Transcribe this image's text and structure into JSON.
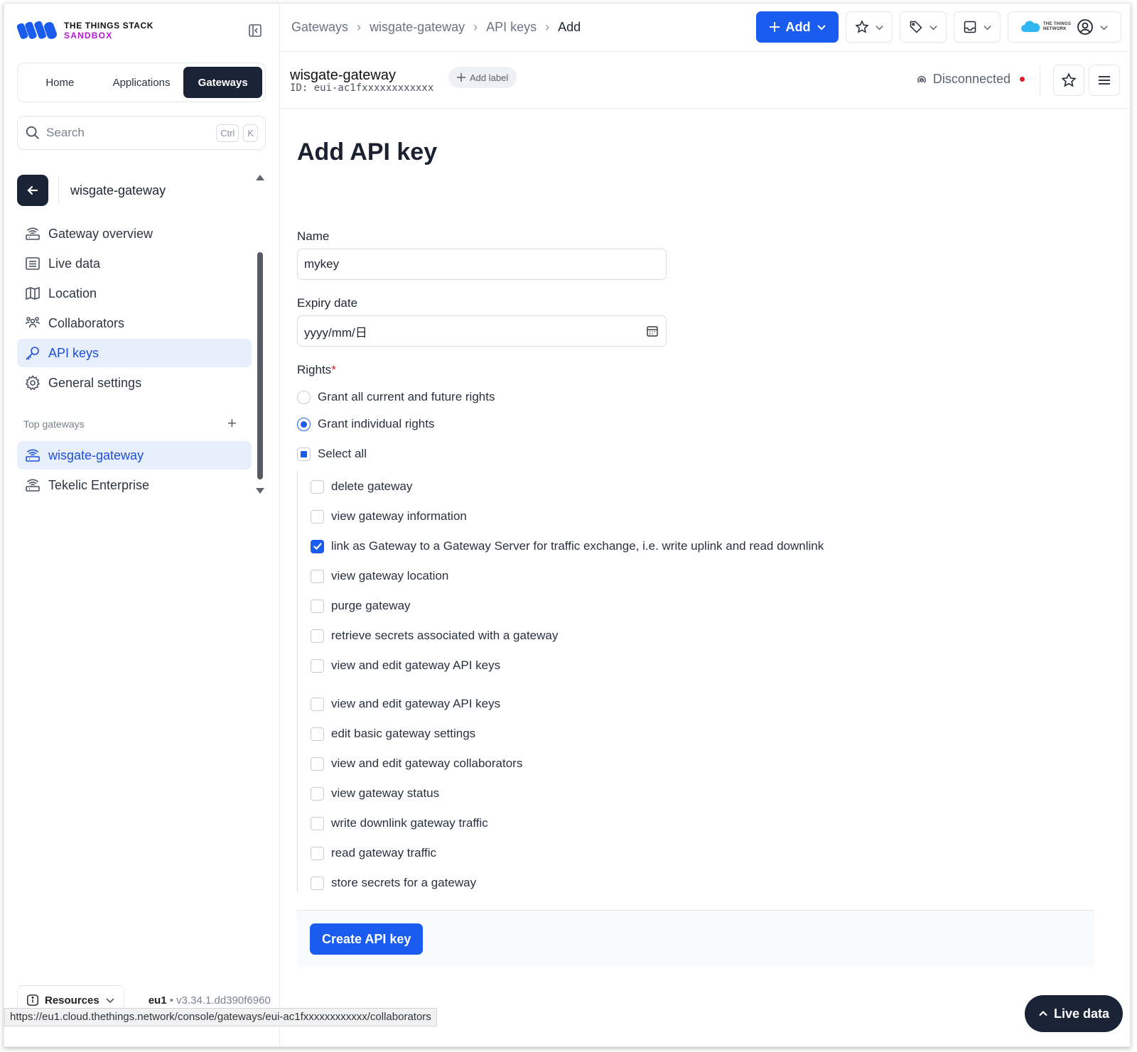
{
  "app": {
    "brand_line1": "THE THINGS STACK",
    "brand_line2": "SANDBOX",
    "accent": "#1a5cf0",
    "dark": "#1b2436"
  },
  "sidebar": {
    "tabs": [
      {
        "label": "Home",
        "active": false
      },
      {
        "label": "Applications",
        "active": false
      },
      {
        "label": "Gateways",
        "active": true
      }
    ],
    "search": {
      "placeholder": "Search",
      "kbd1": "Ctrl",
      "kbd2": "K"
    },
    "entity_name": "wisgate-gateway",
    "nav": [
      {
        "label": "Gateway overview",
        "icon": "gateway-icon",
        "active": false
      },
      {
        "label": "Live data",
        "icon": "list-icon",
        "active": false
      },
      {
        "label": "Location",
        "icon": "map-icon",
        "active": false
      },
      {
        "label": "Collaborators",
        "icon": "users-icon",
        "active": false
      },
      {
        "label": "API keys",
        "icon": "key-icon",
        "active": true
      },
      {
        "label": "General settings",
        "icon": "gear-icon",
        "active": false
      }
    ],
    "top_gateways_label": "Top gateways",
    "top_gateways": [
      {
        "label": "wisgate-gateway",
        "icon": "gateway-icon",
        "active": true
      },
      {
        "label": "Tekelic Enterprise",
        "icon": "gateway-icon",
        "active": false
      }
    ],
    "resources_label": "Resources",
    "cluster": "eu1",
    "version": "v3.34.1.dd390f6960"
  },
  "status_url": "https://eu1.cloud.thethings.network/console/gateways/eui-ac1fxxxxxxxxxxxx/collaborators",
  "topbar": {
    "breadcrumbs": [
      "Gateways",
      "wisgate-gateway",
      "API keys",
      "Add"
    ],
    "add_label": "Add",
    "network_logo_line1": "THE THINGS",
    "network_logo_line2": "NETWORK"
  },
  "header": {
    "title": "wisgate-gateway",
    "id": "ID: eui-ac1fxxxxxxxxxxxx",
    "add_label": "Add label",
    "status": "Disconnected",
    "status_color": "#e11d2a"
  },
  "form": {
    "title": "Add API key",
    "name_label": "Name",
    "name_value": "mykey",
    "expiry_label": "Expiry date",
    "expiry_value": "yyyy/mm/日",
    "rights_label": "Rights",
    "required_mark": "*",
    "grant_all_label": "Grant all current and future rights",
    "grant_individual_label": "Grant individual rights",
    "grant_mode": "individual",
    "select_all_label": "Select all",
    "rights": [
      {
        "label": "delete gateway",
        "checked": false
      },
      {
        "label": "view gateway information",
        "checked": false
      },
      {
        "label": "link as Gateway to a Gateway Server for traffic exchange, i.e. write uplink and read downlink",
        "checked": true
      },
      {
        "label": "view gateway location",
        "checked": false
      },
      {
        "label": "purge gateway",
        "checked": false
      },
      {
        "label": "retrieve secrets associated with a gateway",
        "checked": false
      },
      {
        "label": "view and edit gateway API keys",
        "checked": false
      },
      {
        "label": "view and edit gateway API keys",
        "checked": false
      },
      {
        "label": "edit basic gateway settings",
        "checked": false
      },
      {
        "label": "view and edit gateway collaborators",
        "checked": false
      },
      {
        "label": "view gateway status",
        "checked": false
      },
      {
        "label": "write downlink gateway traffic",
        "checked": false
      },
      {
        "label": "read gateway traffic",
        "checked": false
      },
      {
        "label": "store secrets for a gateway",
        "checked": false
      }
    ],
    "submit_label": "Create API key"
  },
  "live_data_label": "Live data"
}
